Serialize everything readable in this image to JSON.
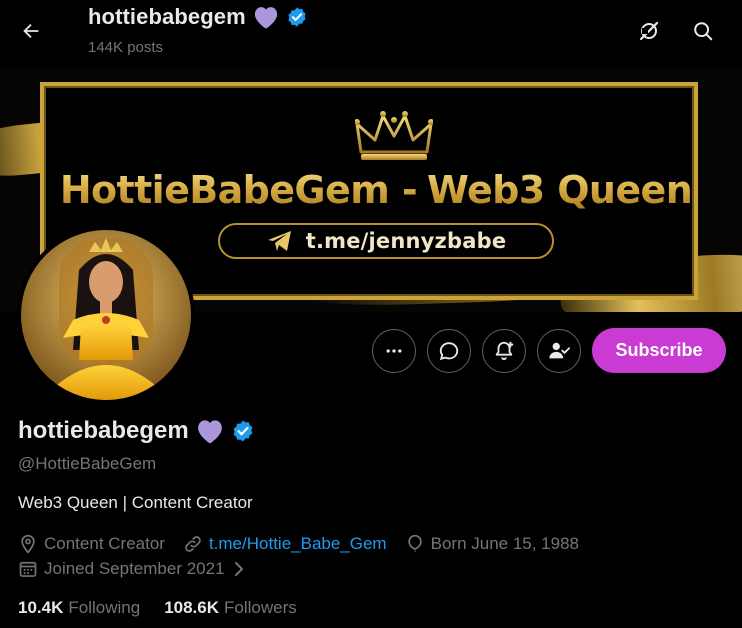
{
  "header": {
    "name": "hottiebabegem",
    "posts": "144K posts"
  },
  "banner": {
    "title_left": "HottieBabeGem -",
    "title_right": "Web3 Queen",
    "link": "t.me/jennyzbabe"
  },
  "actions": {
    "subscribe_label": "Subscribe"
  },
  "profile": {
    "display_name": "hottiebabegem",
    "handle": "@HottieBabeGem",
    "bio": "Web3 Queen | Content Creator",
    "category": "Content Creator",
    "website": "t.me/Hottie_Babe_Gem",
    "birthday": "Born June 15, 1988",
    "joined": "Joined September 2021",
    "following_count": "10.4K",
    "following_label": "Following",
    "followers_count": "108.6K",
    "followers_label": "Followers"
  },
  "colors": {
    "accent_blue": "#1d9bf0",
    "subscribe_purple": "#c93bd3",
    "heart_purple": "#ac97dc",
    "gold": "#d7ad45"
  },
  "icons": [
    "back-arrow-icon",
    "grok-icon",
    "search-icon",
    "more-icon",
    "message-icon",
    "notification-bell-icon",
    "follow-user-icon",
    "purple-heart-icon",
    "verified-badge-icon",
    "location-icon",
    "link-icon",
    "balloon-icon",
    "calendar-icon",
    "chevron-right-icon",
    "crown-icon",
    "telegram-icon"
  ]
}
